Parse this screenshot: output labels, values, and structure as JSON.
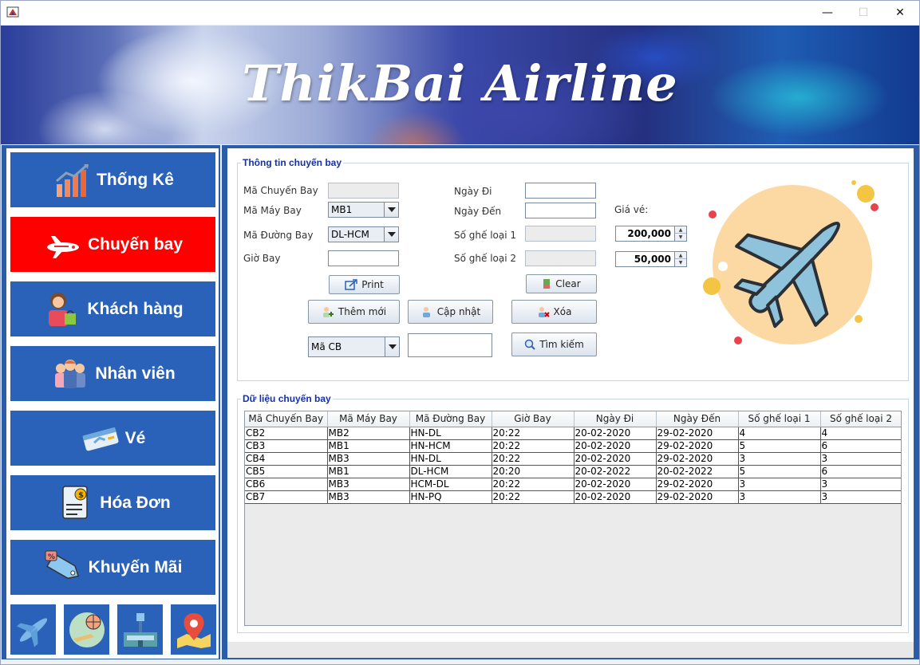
{
  "window": {
    "minimize": "—",
    "maximize": "☐",
    "close": "✕"
  },
  "banner": {
    "title": "ThikBai Airline"
  },
  "sidebar": {
    "items": [
      {
        "label": "Thống Kê",
        "icon": "bar-chart-icon"
      },
      {
        "label": "Chuyến bay",
        "icon": "airplane-icon",
        "active": true
      },
      {
        "label": "Khách hàng",
        "icon": "customer-icon"
      },
      {
        "label": "Nhân viên",
        "icon": "staff-icon"
      },
      {
        "label": "Vé",
        "icon": "ticket-icon"
      },
      {
        "label": "Hóa Đơn",
        "icon": "invoice-icon"
      },
      {
        "label": "Khuyến Mãi",
        "icon": "sale-tag-icon"
      }
    ],
    "quick_icons": [
      "airplane-icon",
      "globe-travel-icon",
      "airport-icon",
      "map-pin-icon"
    ]
  },
  "flight_info": {
    "legend": "Thông tin chuyến bay",
    "labels": {
      "flight_code": "Mã Chuyến Bay",
      "plane_code": "Mã Máy Bay",
      "route_code": "Mã Đường Bay",
      "time": "Giờ Bay",
      "depart_date": "Ngày Đi",
      "arrive_date": "Ngày Đến",
      "seats_1": "Số ghế loại 1",
      "seats_2": "Số ghế loại 2",
      "price": "Giá vé:"
    },
    "values": {
      "flight_code": "",
      "plane_code": "MB1",
      "route_code": "DL-HCM",
      "time": "",
      "depart_date": "",
      "arrive_date": "",
      "seats_1": "",
      "seats_2": "",
      "price_1": "200,000",
      "price_2": "50,000"
    },
    "buttons": {
      "print": "Print",
      "clear": "Clear",
      "add": "Thêm mới",
      "update": "Cập nhật",
      "delete": "Xóa",
      "search": "Tìm kiếm"
    },
    "search": {
      "field": "Mã CB",
      "query": ""
    }
  },
  "flight_data": {
    "legend": "Dữ liệu chuyến bay",
    "columns": [
      "Mã Chuyến Bay",
      "Mã Máy Bay",
      "Mã Đường Bay",
      "Giờ Bay",
      "Ngày Đi",
      "Ngày Đến",
      "Số ghế loại 1",
      "Số ghế loại 2"
    ],
    "rows": [
      [
        "CB2",
        "MB2",
        "HN-DL",
        "20:22",
        "20-02-2020",
        "29-02-2020",
        "4",
        "4"
      ],
      [
        "CB3",
        "MB1",
        "HN-HCM",
        "20:22",
        "20-02-2020",
        "29-02-2020",
        "5",
        "6"
      ],
      [
        "CB4",
        "MB3",
        "HN-DL",
        "20:22",
        "20-02-2020",
        "29-02-2020",
        "3",
        "3"
      ],
      [
        "CB5",
        "MB1",
        "DL-HCM",
        "20:20",
        "20-02-2022",
        "20-02-2022",
        "5",
        "6"
      ],
      [
        "CB6",
        "MB3",
        "HCM-DL",
        "20:22",
        "20-02-2020",
        "29-02-2020",
        "3",
        "3"
      ],
      [
        "CB7",
        "MB3",
        "HN-PQ",
        "20:22",
        "20-02-2020",
        "29-02-2020",
        "3",
        "3"
      ]
    ]
  },
  "colors": {
    "nav_blue": "#2b62b9",
    "nav_active": "#ff0000",
    "legend_text": "#1531a8"
  }
}
